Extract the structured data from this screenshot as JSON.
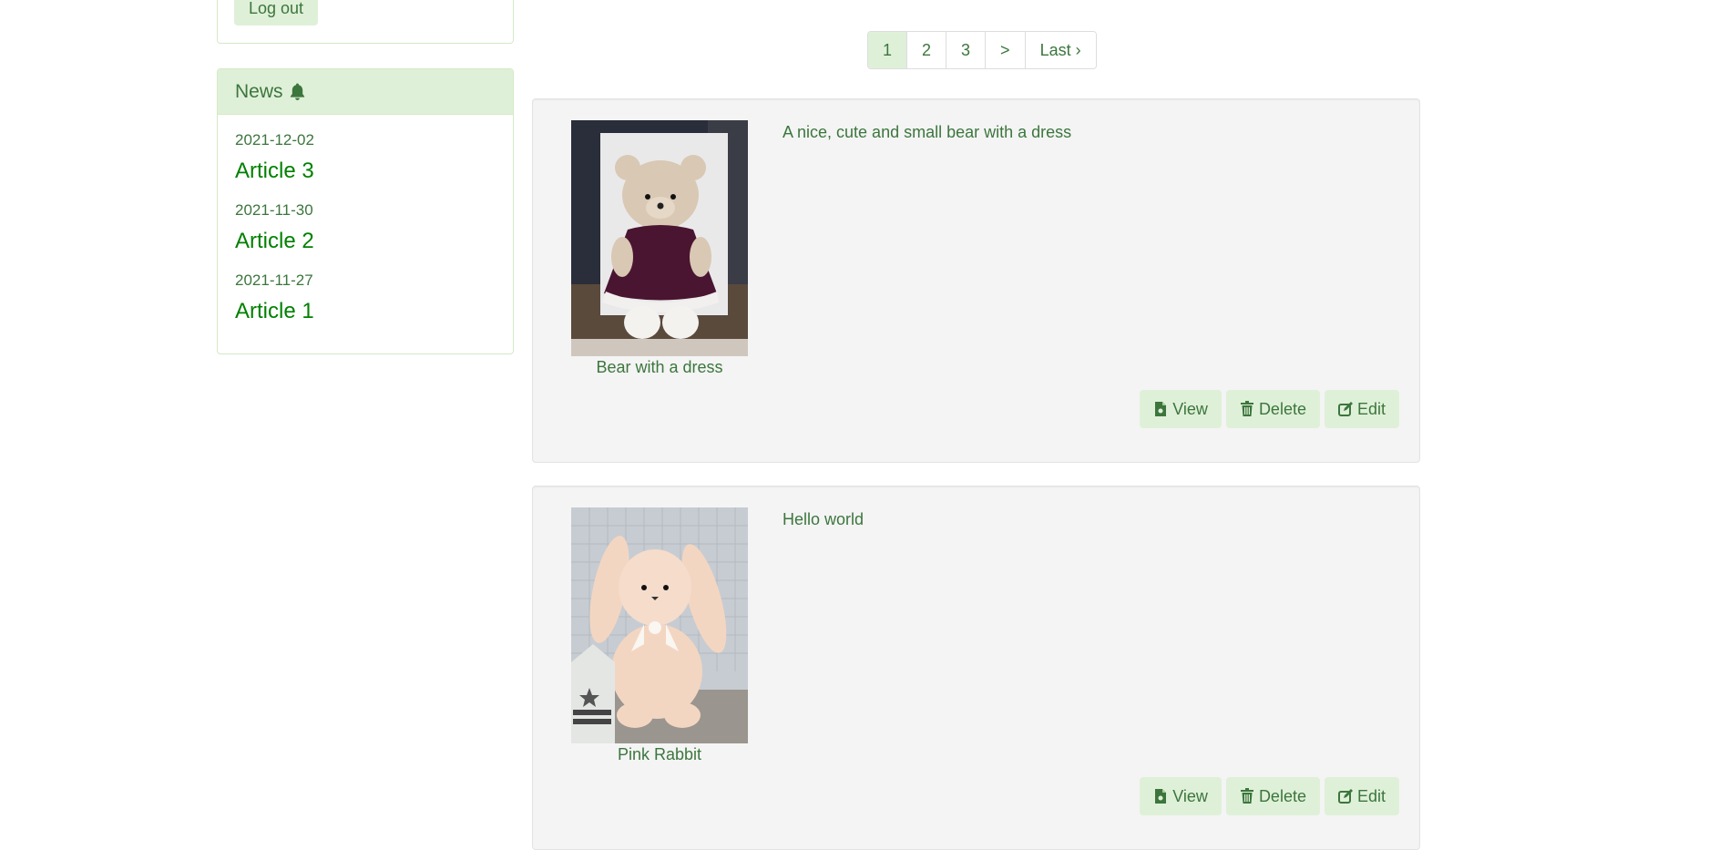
{
  "sidebar": {
    "logout_label": "Log out",
    "news": {
      "title": "News",
      "items": [
        {
          "date": "2021-12-02",
          "title": "Article 3"
        },
        {
          "date": "2021-11-30",
          "title": "Article 2"
        },
        {
          "date": "2021-11-27",
          "title": "Article 1"
        }
      ]
    }
  },
  "pagination": {
    "pages": [
      "1",
      "2",
      "3",
      ">",
      "Last ›"
    ],
    "active": "1"
  },
  "products": [
    {
      "name": "Bear with a dress",
      "description": "A nice, cute and small bear with a dress",
      "image_icon": "bear-photo",
      "actions": {
        "view": "View",
        "delete": "Delete",
        "edit": "Edit"
      }
    },
    {
      "name": "Pink Rabbit",
      "description": "Hello world",
      "image_icon": "rabbit-photo",
      "actions": {
        "view": "View",
        "delete": "Delete",
        "edit": "Edit"
      }
    }
  ],
  "colors": {
    "accent_bg": "#dff0d8",
    "text": "#3c763d",
    "link": "#008000",
    "card_bg": "#f4f4f4"
  }
}
